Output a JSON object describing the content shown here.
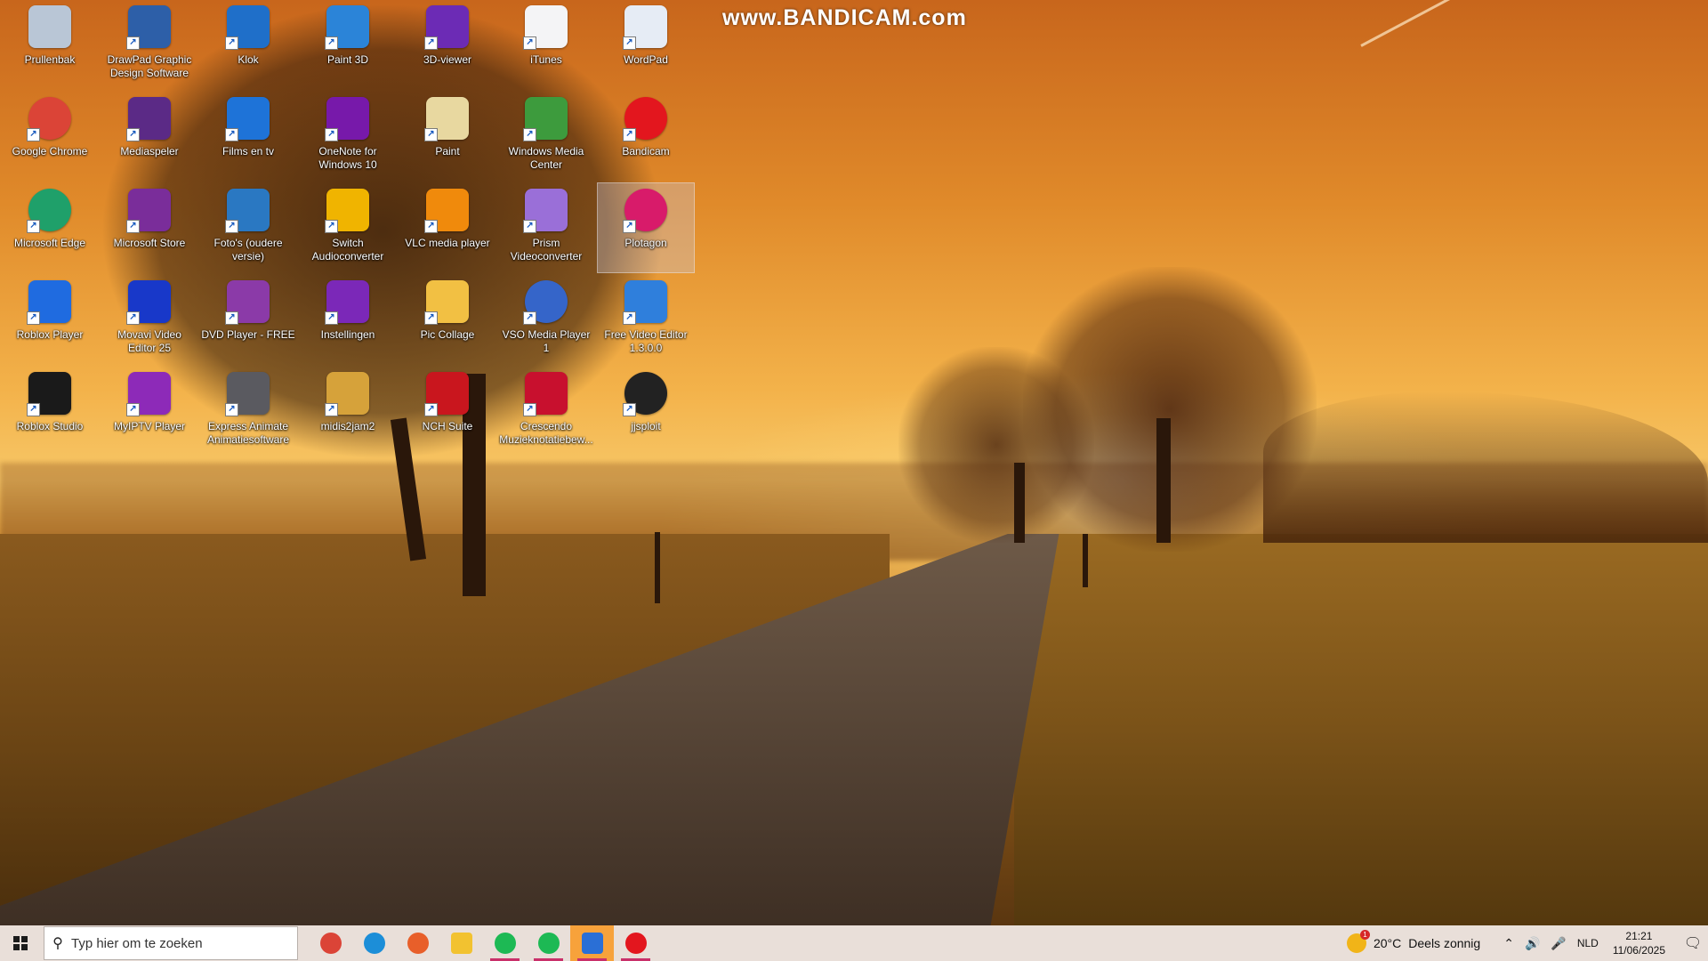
{
  "watermark": "www.BANDICAM.com",
  "desktop_icons": [
    {
      "label": "Prullenbak",
      "icon": "recycle-bin-icon",
      "color": "#b9c6d6"
    },
    {
      "label": "DrawPad Graphic Design Software",
      "icon": "drawpad-icon",
      "color": "#2d5fa8"
    },
    {
      "label": "Klok",
      "icon": "clock-icon",
      "color": "#1f6fc9"
    },
    {
      "label": "Paint 3D",
      "icon": "paint-3d-icon",
      "color": "#2b84d8"
    },
    {
      "label": "3D-viewer",
      "icon": "cube-icon",
      "color": "#6c2bb5"
    },
    {
      "label": "iTunes",
      "icon": "itunes-icon",
      "color": "#f4f4f6"
    },
    {
      "label": "WordPad",
      "icon": "wordpad-icon",
      "color": "#e6ecf5"
    },
    {
      "label": "Google Chrome",
      "icon": "chrome-icon",
      "color": "#db4437"
    },
    {
      "label": "Mediaspeler",
      "icon": "media-player-icon",
      "color": "#5b2a86"
    },
    {
      "label": "Films en tv",
      "icon": "films-tv-icon",
      "color": "#1e73d8"
    },
    {
      "label": "OneNote for Windows 10",
      "icon": "onenote-icon",
      "color": "#7719aa"
    },
    {
      "label": "Paint",
      "icon": "paint-palette-icon",
      "color": "#e8d8a0"
    },
    {
      "label": "Windows Media Center",
      "icon": "windows-media-center-icon",
      "color": "#3d9b3d"
    },
    {
      "label": "Bandicam",
      "icon": "bandicam-record-icon",
      "color": "#e3161e"
    },
    {
      "label": "Microsoft Edge",
      "icon": "edge-icon",
      "color": "#1fa06a"
    },
    {
      "label": "Microsoft Store",
      "icon": "store-icon",
      "color": "#7a2d9a"
    },
    {
      "label": "Foto's (oudere versie)",
      "icon": "photos-icon",
      "color": "#2a78c2"
    },
    {
      "label": "Switch Audioconverter",
      "icon": "switch-audio-icon",
      "color": "#f0b400"
    },
    {
      "label": "VLC media player",
      "icon": "vlc-cone-icon",
      "color": "#f08a0c"
    },
    {
      "label": "Prism Videoconverter",
      "icon": "prism-icon",
      "color": "#9a6fd8"
    },
    {
      "label": "Plotagon",
      "icon": "plotagon-icon",
      "color": "#d81b6a"
    },
    {
      "label": "Roblox Player",
      "icon": "roblox-player-icon",
      "color": "#1f6be0"
    },
    {
      "label": "Movavi Video Editor 25",
      "icon": "movavi-icon",
      "color": "#1838c9"
    },
    {
      "label": "DVD Player - FREE",
      "icon": "dvd-icon",
      "color": "#8b3aa8"
    },
    {
      "label": "Instellingen",
      "icon": "gear-icon",
      "color": "#7b28b8"
    },
    {
      "label": "Pic Collage",
      "icon": "pic-collage-icon",
      "color": "#f2c043"
    },
    {
      "label": "VSO Media Player 1",
      "icon": "vso-play-icon",
      "color": "#3565c9"
    },
    {
      "label": "Free Video Editor 1.3.0.0",
      "icon": "film-reel-icon",
      "color": "#2f7fdc"
    },
    {
      "label": "Roblox Studio",
      "icon": "roblox-studio-icon",
      "color": "#1a1a1a"
    },
    {
      "label": "MyIPTV Player",
      "icon": "iptv-icon",
      "color": "#8d2ab8"
    },
    {
      "label": "Express Animate Animatiesoftware",
      "icon": "express-animate-icon",
      "color": "#5a5a60"
    },
    {
      "label": "midis2jam2",
      "icon": "saxophone-icon",
      "color": "#d6a23a"
    },
    {
      "label": "NCH Suite",
      "icon": "nch-suite-icon",
      "color": "#c9161e"
    },
    {
      "label": "Crescendo Muzieknotatiebew...",
      "icon": "crescendo-icon",
      "color": "#c8102e"
    },
    {
      "label": "jjsploit",
      "icon": "jjsploit-icon",
      "color": "#222222"
    }
  ],
  "taskbar": {
    "search_placeholder": "Typ hier om te zoeken",
    "pinned": [
      {
        "name": "chrome",
        "icon": "chrome-icon",
        "color": "#db4437",
        "active": false
      },
      {
        "name": "edge",
        "icon": "edge-icon",
        "color": "#1c8ed8",
        "active": false
      },
      {
        "name": "firefox",
        "icon": "firefox-icon",
        "color": "#e85f2a",
        "active": false
      },
      {
        "name": "file-explorer",
        "icon": "folder-icon",
        "color": "#f2c230",
        "active": false
      },
      {
        "name": "spotify",
        "icon": "spotify-icon",
        "color": "#1db954",
        "active": false
      },
      {
        "name": "spotify-2",
        "icon": "spotify-icon",
        "color": "#1db954",
        "active": false
      },
      {
        "name": "pic-collage",
        "icon": "pic-collage-icon",
        "color": "#2a6fd6",
        "active": true
      },
      {
        "name": "bandicam",
        "icon": "bandicam-record-icon",
        "color": "#e3161e",
        "active": false
      }
    ],
    "weather": {
      "temp": "20°C",
      "desc": "Deels zonnig",
      "badge": "1"
    },
    "language": "NLD",
    "time": "21:21",
    "date": "11/06/2025"
  }
}
